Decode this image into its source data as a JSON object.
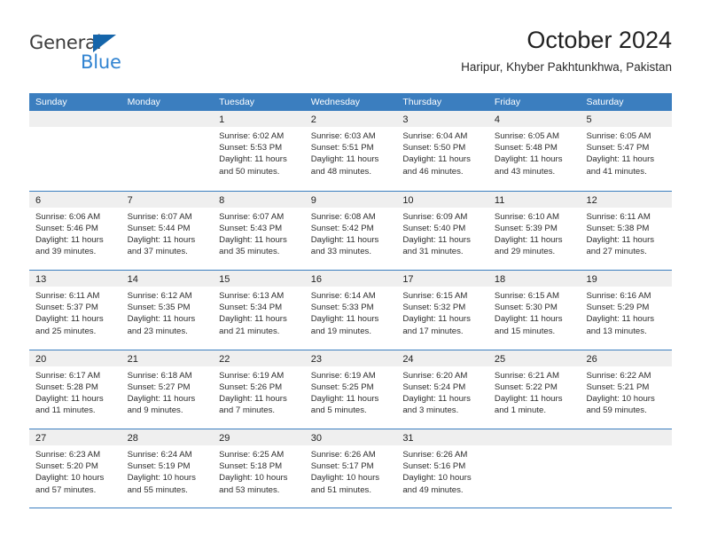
{
  "brand": {
    "name_part1": "General",
    "name_part2": "Blue",
    "logo_icon": "triangle-logo-icon",
    "accent_color": "#3083d1",
    "dark_color": "#3c3c3c"
  },
  "header": {
    "title": "October 2024",
    "subtitle": "Haripur, Khyber Pakhtunkhwa, Pakistan"
  },
  "theme": {
    "header_blue": "#3b7ebf",
    "date_band_gray": "#efefef",
    "text_color": "#2d2d2d"
  },
  "weekdays": [
    "Sunday",
    "Monday",
    "Tuesday",
    "Wednesday",
    "Thursday",
    "Friday",
    "Saturday"
  ],
  "weeks": [
    [
      {
        "date": "",
        "empty": true,
        "sunrise": "",
        "sunset": "",
        "daylight1": "",
        "daylight2": ""
      },
      {
        "date": "",
        "empty": true,
        "sunrise": "",
        "sunset": "",
        "daylight1": "",
        "daylight2": ""
      },
      {
        "date": "1",
        "empty": false,
        "sunrise": "Sunrise: 6:02 AM",
        "sunset": "Sunset: 5:53 PM",
        "daylight1": "Daylight: 11 hours",
        "daylight2": "and 50 minutes."
      },
      {
        "date": "2",
        "empty": false,
        "sunrise": "Sunrise: 6:03 AM",
        "sunset": "Sunset: 5:51 PM",
        "daylight1": "Daylight: 11 hours",
        "daylight2": "and 48 minutes."
      },
      {
        "date": "3",
        "empty": false,
        "sunrise": "Sunrise: 6:04 AM",
        "sunset": "Sunset: 5:50 PM",
        "daylight1": "Daylight: 11 hours",
        "daylight2": "and 46 minutes."
      },
      {
        "date": "4",
        "empty": false,
        "sunrise": "Sunrise: 6:05 AM",
        "sunset": "Sunset: 5:48 PM",
        "daylight1": "Daylight: 11 hours",
        "daylight2": "and 43 minutes."
      },
      {
        "date": "5",
        "empty": false,
        "sunrise": "Sunrise: 6:05 AM",
        "sunset": "Sunset: 5:47 PM",
        "daylight1": "Daylight: 11 hours",
        "daylight2": "and 41 minutes."
      }
    ],
    [
      {
        "date": "6",
        "empty": false,
        "sunrise": "Sunrise: 6:06 AM",
        "sunset": "Sunset: 5:46 PM",
        "daylight1": "Daylight: 11 hours",
        "daylight2": "and 39 minutes."
      },
      {
        "date": "7",
        "empty": false,
        "sunrise": "Sunrise: 6:07 AM",
        "sunset": "Sunset: 5:44 PM",
        "daylight1": "Daylight: 11 hours",
        "daylight2": "and 37 minutes."
      },
      {
        "date": "8",
        "empty": false,
        "sunrise": "Sunrise: 6:07 AM",
        "sunset": "Sunset: 5:43 PM",
        "daylight1": "Daylight: 11 hours",
        "daylight2": "and 35 minutes."
      },
      {
        "date": "9",
        "empty": false,
        "sunrise": "Sunrise: 6:08 AM",
        "sunset": "Sunset: 5:42 PM",
        "daylight1": "Daylight: 11 hours",
        "daylight2": "and 33 minutes."
      },
      {
        "date": "10",
        "empty": false,
        "sunrise": "Sunrise: 6:09 AM",
        "sunset": "Sunset: 5:40 PM",
        "daylight1": "Daylight: 11 hours",
        "daylight2": "and 31 minutes."
      },
      {
        "date": "11",
        "empty": false,
        "sunrise": "Sunrise: 6:10 AM",
        "sunset": "Sunset: 5:39 PM",
        "daylight1": "Daylight: 11 hours",
        "daylight2": "and 29 minutes."
      },
      {
        "date": "12",
        "empty": false,
        "sunrise": "Sunrise: 6:11 AM",
        "sunset": "Sunset: 5:38 PM",
        "daylight1": "Daylight: 11 hours",
        "daylight2": "and 27 minutes."
      }
    ],
    [
      {
        "date": "13",
        "empty": false,
        "sunrise": "Sunrise: 6:11 AM",
        "sunset": "Sunset: 5:37 PM",
        "daylight1": "Daylight: 11 hours",
        "daylight2": "and 25 minutes."
      },
      {
        "date": "14",
        "empty": false,
        "sunrise": "Sunrise: 6:12 AM",
        "sunset": "Sunset: 5:35 PM",
        "daylight1": "Daylight: 11 hours",
        "daylight2": "and 23 minutes."
      },
      {
        "date": "15",
        "empty": false,
        "sunrise": "Sunrise: 6:13 AM",
        "sunset": "Sunset: 5:34 PM",
        "daylight1": "Daylight: 11 hours",
        "daylight2": "and 21 minutes."
      },
      {
        "date": "16",
        "empty": false,
        "sunrise": "Sunrise: 6:14 AM",
        "sunset": "Sunset: 5:33 PM",
        "daylight1": "Daylight: 11 hours",
        "daylight2": "and 19 minutes."
      },
      {
        "date": "17",
        "empty": false,
        "sunrise": "Sunrise: 6:15 AM",
        "sunset": "Sunset: 5:32 PM",
        "daylight1": "Daylight: 11 hours",
        "daylight2": "and 17 minutes."
      },
      {
        "date": "18",
        "empty": false,
        "sunrise": "Sunrise: 6:15 AM",
        "sunset": "Sunset: 5:30 PM",
        "daylight1": "Daylight: 11 hours",
        "daylight2": "and 15 minutes."
      },
      {
        "date": "19",
        "empty": false,
        "sunrise": "Sunrise: 6:16 AM",
        "sunset": "Sunset: 5:29 PM",
        "daylight1": "Daylight: 11 hours",
        "daylight2": "and 13 minutes."
      }
    ],
    [
      {
        "date": "20",
        "empty": false,
        "sunrise": "Sunrise: 6:17 AM",
        "sunset": "Sunset: 5:28 PM",
        "daylight1": "Daylight: 11 hours",
        "daylight2": "and 11 minutes."
      },
      {
        "date": "21",
        "empty": false,
        "sunrise": "Sunrise: 6:18 AM",
        "sunset": "Sunset: 5:27 PM",
        "daylight1": "Daylight: 11 hours",
        "daylight2": "and 9 minutes."
      },
      {
        "date": "22",
        "empty": false,
        "sunrise": "Sunrise: 6:19 AM",
        "sunset": "Sunset: 5:26 PM",
        "daylight1": "Daylight: 11 hours",
        "daylight2": "and 7 minutes."
      },
      {
        "date": "23",
        "empty": false,
        "sunrise": "Sunrise: 6:19 AM",
        "sunset": "Sunset: 5:25 PM",
        "daylight1": "Daylight: 11 hours",
        "daylight2": "and 5 minutes."
      },
      {
        "date": "24",
        "empty": false,
        "sunrise": "Sunrise: 6:20 AM",
        "sunset": "Sunset: 5:24 PM",
        "daylight1": "Daylight: 11 hours",
        "daylight2": "and 3 minutes."
      },
      {
        "date": "25",
        "empty": false,
        "sunrise": "Sunrise: 6:21 AM",
        "sunset": "Sunset: 5:22 PM",
        "daylight1": "Daylight: 11 hours",
        "daylight2": "and 1 minute."
      },
      {
        "date": "26",
        "empty": false,
        "sunrise": "Sunrise: 6:22 AM",
        "sunset": "Sunset: 5:21 PM",
        "daylight1": "Daylight: 10 hours",
        "daylight2": "and 59 minutes."
      }
    ],
    [
      {
        "date": "27",
        "empty": false,
        "sunrise": "Sunrise: 6:23 AM",
        "sunset": "Sunset: 5:20 PM",
        "daylight1": "Daylight: 10 hours",
        "daylight2": "and 57 minutes."
      },
      {
        "date": "28",
        "empty": false,
        "sunrise": "Sunrise: 6:24 AM",
        "sunset": "Sunset: 5:19 PM",
        "daylight1": "Daylight: 10 hours",
        "daylight2": "and 55 minutes."
      },
      {
        "date": "29",
        "empty": false,
        "sunrise": "Sunrise: 6:25 AM",
        "sunset": "Sunset: 5:18 PM",
        "daylight1": "Daylight: 10 hours",
        "daylight2": "and 53 minutes."
      },
      {
        "date": "30",
        "empty": false,
        "sunrise": "Sunrise: 6:26 AM",
        "sunset": "Sunset: 5:17 PM",
        "daylight1": "Daylight: 10 hours",
        "daylight2": "and 51 minutes."
      },
      {
        "date": "31",
        "empty": false,
        "sunrise": "Sunrise: 6:26 AM",
        "sunset": "Sunset: 5:16 PM",
        "daylight1": "Daylight: 10 hours",
        "daylight2": "and 49 minutes."
      },
      {
        "date": "",
        "empty": true,
        "sunrise": "",
        "sunset": "",
        "daylight1": "",
        "daylight2": ""
      },
      {
        "date": "",
        "empty": true,
        "sunrise": "",
        "sunset": "",
        "daylight1": "",
        "daylight2": ""
      }
    ]
  ]
}
